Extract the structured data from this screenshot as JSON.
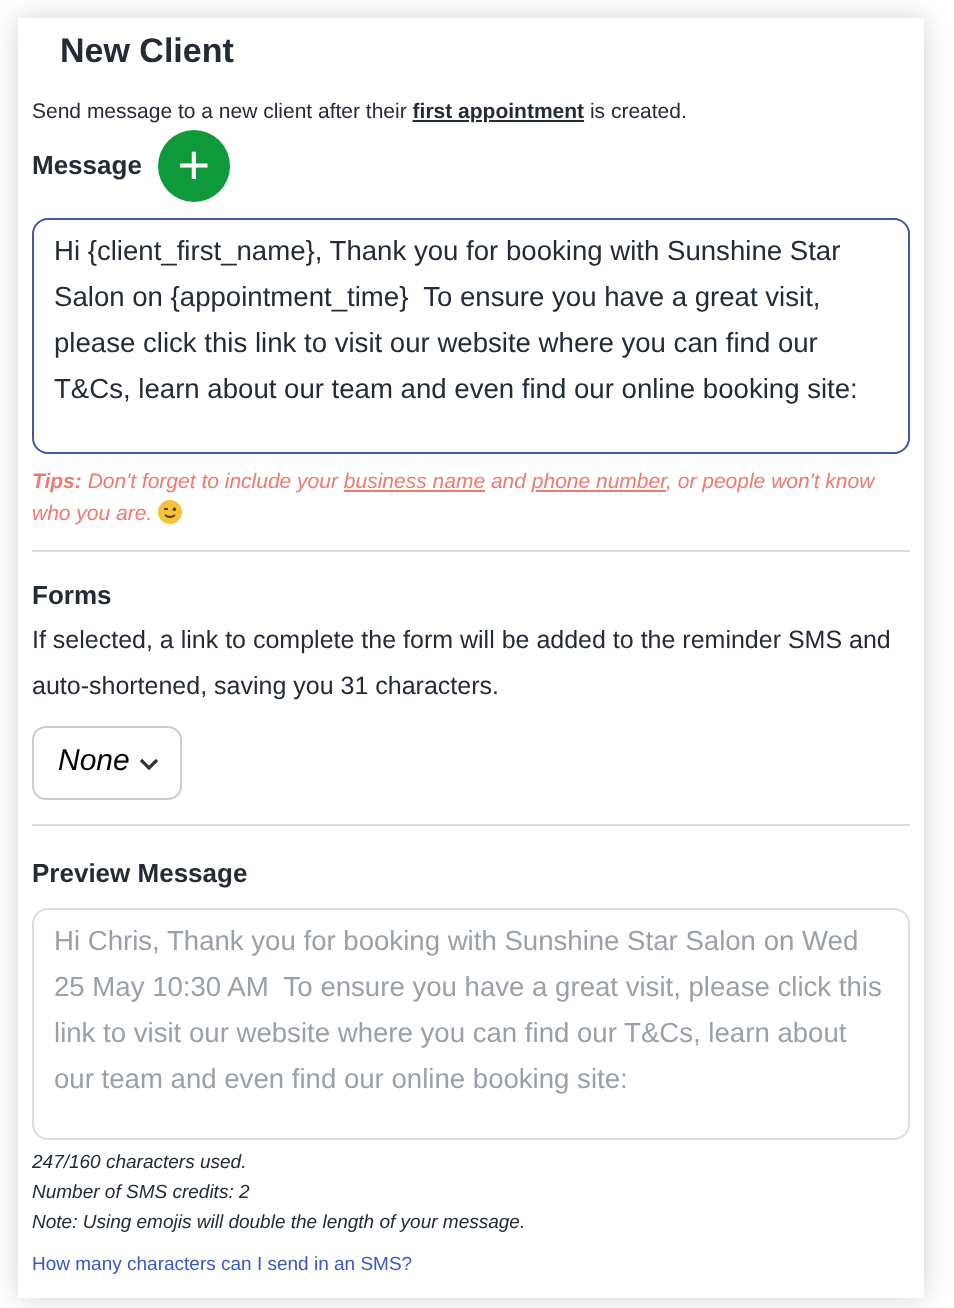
{
  "title": "New Client",
  "intro": [
    {
      "kind": "text",
      "text": "Send message to a new client after their "
    },
    {
      "kind": "link",
      "text": "first appointment"
    },
    {
      "kind": "text",
      "text": " is created."
    }
  ],
  "message": {
    "label": "Message",
    "add_button": "+",
    "value": "Hi {client_first_name}, Thank you for booking with Sunshine Star Salon on {appointment_time}  To ensure you have a great visit, please click this link to visit our website where you can find our T&Cs, learn about our team and even find our online booking site:"
  },
  "tips": [
    {
      "kind": "label",
      "text": "Tips:"
    },
    {
      "kind": "text",
      "text": " Don't forget to include your "
    },
    {
      "kind": "link",
      "text": "business name"
    },
    {
      "kind": "text",
      "text": " and "
    },
    {
      "kind": "link",
      "text": "phone number"
    },
    {
      "kind": "text",
      "text": ", or people won't know who you are."
    },
    {
      "kind": "emoji"
    }
  ],
  "forms": {
    "label": "Forms",
    "description": "If selected, a link to complete the form will be added to the reminder SMS and auto-shortened, saving you 31 characters.",
    "select": "None"
  },
  "preview": {
    "label": "Preview Message",
    "value": "Hi Chris, Thank you for booking with Sunshine Star Salon on Wed 25 May 10:30 AM  To ensure you have a great visit, please click this link to visit our website where you can find our T&Cs, learn about our team and even find our online booking site:"
  },
  "notes": [
    "247/160 characters used.",
    "Number of SMS credits: 2",
    "Note: Using emojis will double the length of your message."
  ],
  "help_link": "How many characters can I send in an SMS?"
}
